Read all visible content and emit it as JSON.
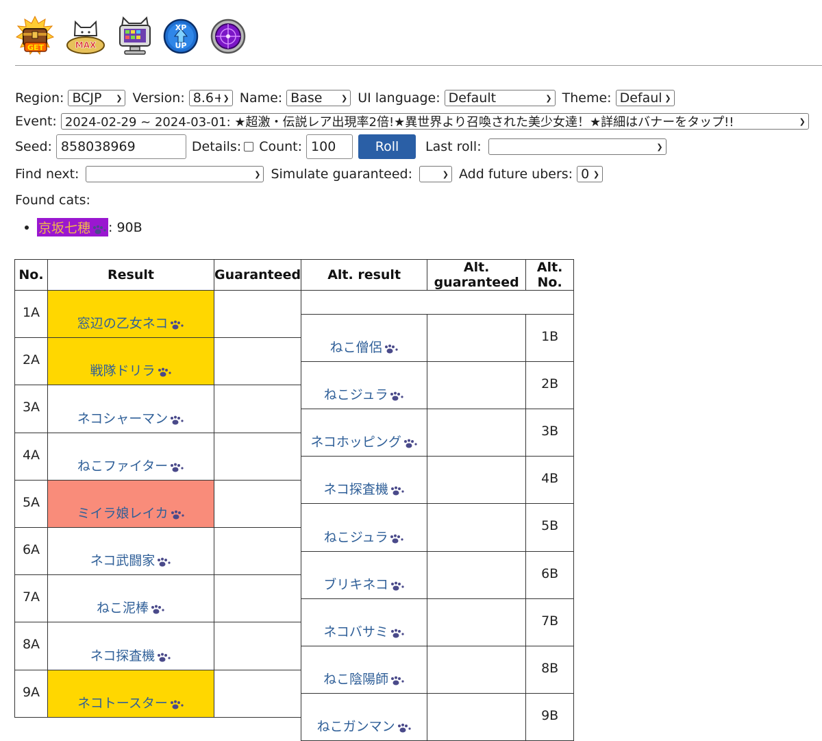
{
  "icons": [
    {
      "name": "treasure-get-icon",
      "text": "GET"
    },
    {
      "name": "max-cat-icon",
      "text": "MAX"
    },
    {
      "name": "monitor-cat-icon"
    },
    {
      "name": "xp-up-icon",
      "text_top": "XP",
      "text_bottom": "UP"
    },
    {
      "name": "purple-orb-icon"
    }
  ],
  "controls": {
    "region_label": "Region:",
    "region_value": "BCJP",
    "version_label": "Version:",
    "version_value": "8.6+",
    "name_label": "Name:",
    "name_value": "Base",
    "ui_language_label": "UI language:",
    "ui_language_value": "Default",
    "theme_label": "Theme:",
    "theme_value": "Default",
    "event_label": "Event:",
    "event_value": "2024-02-29 ~ 2024-03-01: ★超激・伝説レア出現率2倍!★異世界より召喚された美少女達！★詳細はバナーをタップ!!",
    "seed_label": "Seed:",
    "seed_value": "858038969",
    "details_label": "Details:",
    "count_label": "Count:",
    "count_value": "100",
    "roll_button": "Roll",
    "last_roll_label": "Last roll:",
    "last_roll_value": "",
    "find_next_label": "Find next:",
    "find_next_value": "",
    "simulate_guaranteed_label": "Simulate guaranteed:",
    "simulate_guaranteed_value": "",
    "add_future_ubers_label": "Add future ubers:",
    "add_future_ubers_value": "0"
  },
  "found": {
    "label": "Found cats:",
    "items": [
      {
        "cat": "京坂七穂",
        "suffix": ": 90B"
      }
    ]
  },
  "table": {
    "headers": [
      "No.",
      "Result",
      "Guaranteed",
      "Alt. result",
      "Alt. guaranteed",
      "Alt. No."
    ],
    "rows": [
      {
        "no": "1A",
        "result": "窓辺の乙女ネコ",
        "rarity": "uber",
        "alt_no": "1B",
        "alt_result": "ねこ僧侶"
      },
      {
        "no": "2A",
        "result": "戦隊ドリラ",
        "rarity": "uber",
        "alt_no": "2B",
        "alt_result": "ねこジュラ"
      },
      {
        "no": "3A",
        "result": "ネコシャーマン",
        "rarity": "rare",
        "alt_no": "3B",
        "alt_result": "ネコホッピング"
      },
      {
        "no": "4A",
        "result": "ねこファイター",
        "rarity": "rare",
        "alt_no": "4B",
        "alt_result": "ネコ探査機"
      },
      {
        "no": "5A",
        "result": "ミイラ娘レイカ",
        "rarity": "super",
        "alt_no": "5B",
        "alt_result": "ねこジュラ"
      },
      {
        "no": "6A",
        "result": "ネコ武闘家",
        "rarity": "rare",
        "alt_no": "6B",
        "alt_result": "ブリキネコ"
      },
      {
        "no": "7A",
        "result": "ねこ泥棒",
        "rarity": "rare",
        "alt_no": "7B",
        "alt_result": "ネコバサミ"
      },
      {
        "no": "8A",
        "result": "ネコ探査機",
        "rarity": "rare",
        "alt_no": "8B",
        "alt_result": "ねこ陰陽師"
      },
      {
        "no": "9A",
        "result": "ネコトースター",
        "rarity": "uber",
        "alt_no": "9B",
        "alt_result": "ねこガンマン"
      }
    ]
  },
  "colors": {
    "uber": "#ffd700",
    "super": "#f98c7a",
    "rare": "#ffffff",
    "link": "#2f5f98",
    "roll_button": "#2a5fa6",
    "found_highlight_bg": "#9a17d0",
    "found_highlight_text": "#f0b84c",
    "paw": "#4a4a8a"
  }
}
